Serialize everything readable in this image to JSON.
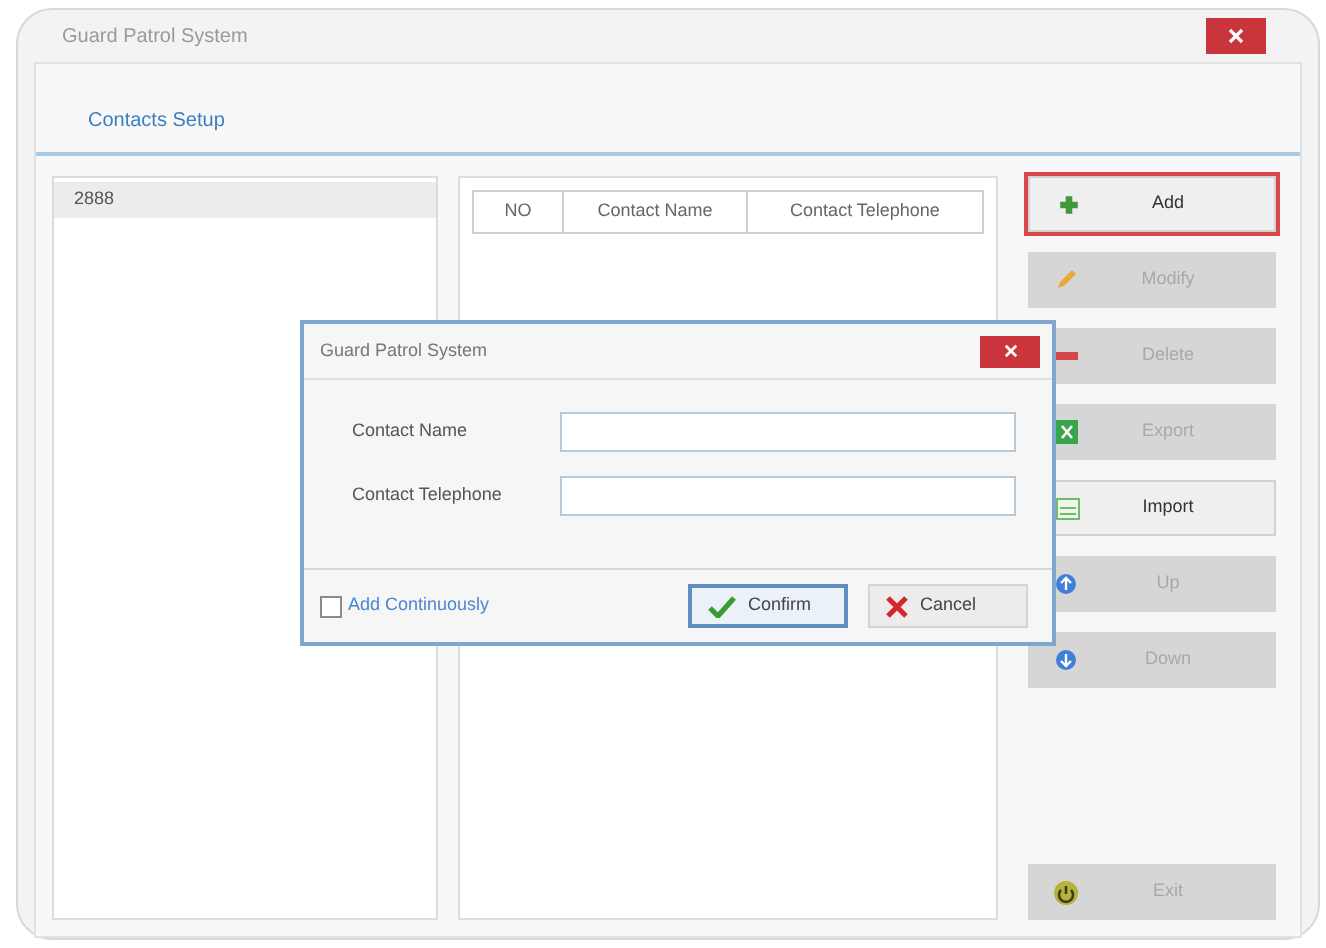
{
  "window": {
    "title": "Guard Patrol System"
  },
  "header": {
    "title": "Contacts Setup"
  },
  "tree": {
    "items": [
      {
        "label": "2888",
        "selected": true
      }
    ]
  },
  "table": {
    "columns": [
      "NO",
      "Contact Name",
      "Contact Telephone"
    ]
  },
  "buttons": [
    {
      "label": "Add",
      "kind": "add",
      "disabled": false,
      "highlighted": true
    },
    {
      "label": "Modify",
      "kind": "modify",
      "disabled": true,
      "highlighted": false
    },
    {
      "label": "Delete",
      "kind": "delete",
      "disabled": true,
      "highlighted": false
    },
    {
      "label": "Export",
      "kind": "export",
      "disabled": true,
      "highlighted": false
    },
    {
      "label": "Import",
      "kind": "import",
      "disabled": false,
      "highlighted": false
    },
    {
      "label": "Up",
      "kind": "up",
      "disabled": true,
      "highlighted": false
    },
    {
      "label": "Down",
      "kind": "down",
      "disabled": true,
      "highlighted": false
    }
  ],
  "exit_button": {
    "label": "Exit",
    "kind": "exit",
    "disabled": true
  },
  "dialog": {
    "title": "Guard Patrol System",
    "fields": [
      {
        "label": "Contact Name"
      },
      {
        "label": "Contact Telephone"
      }
    ],
    "checkbox": {
      "label": "Add Continuously",
      "checked": false
    },
    "buttons": [
      {
        "label": "Confirm",
        "kind": "confirm",
        "focused": true
      },
      {
        "label": "Cancel",
        "kind": "cancel",
        "focused": false
      }
    ]
  }
}
